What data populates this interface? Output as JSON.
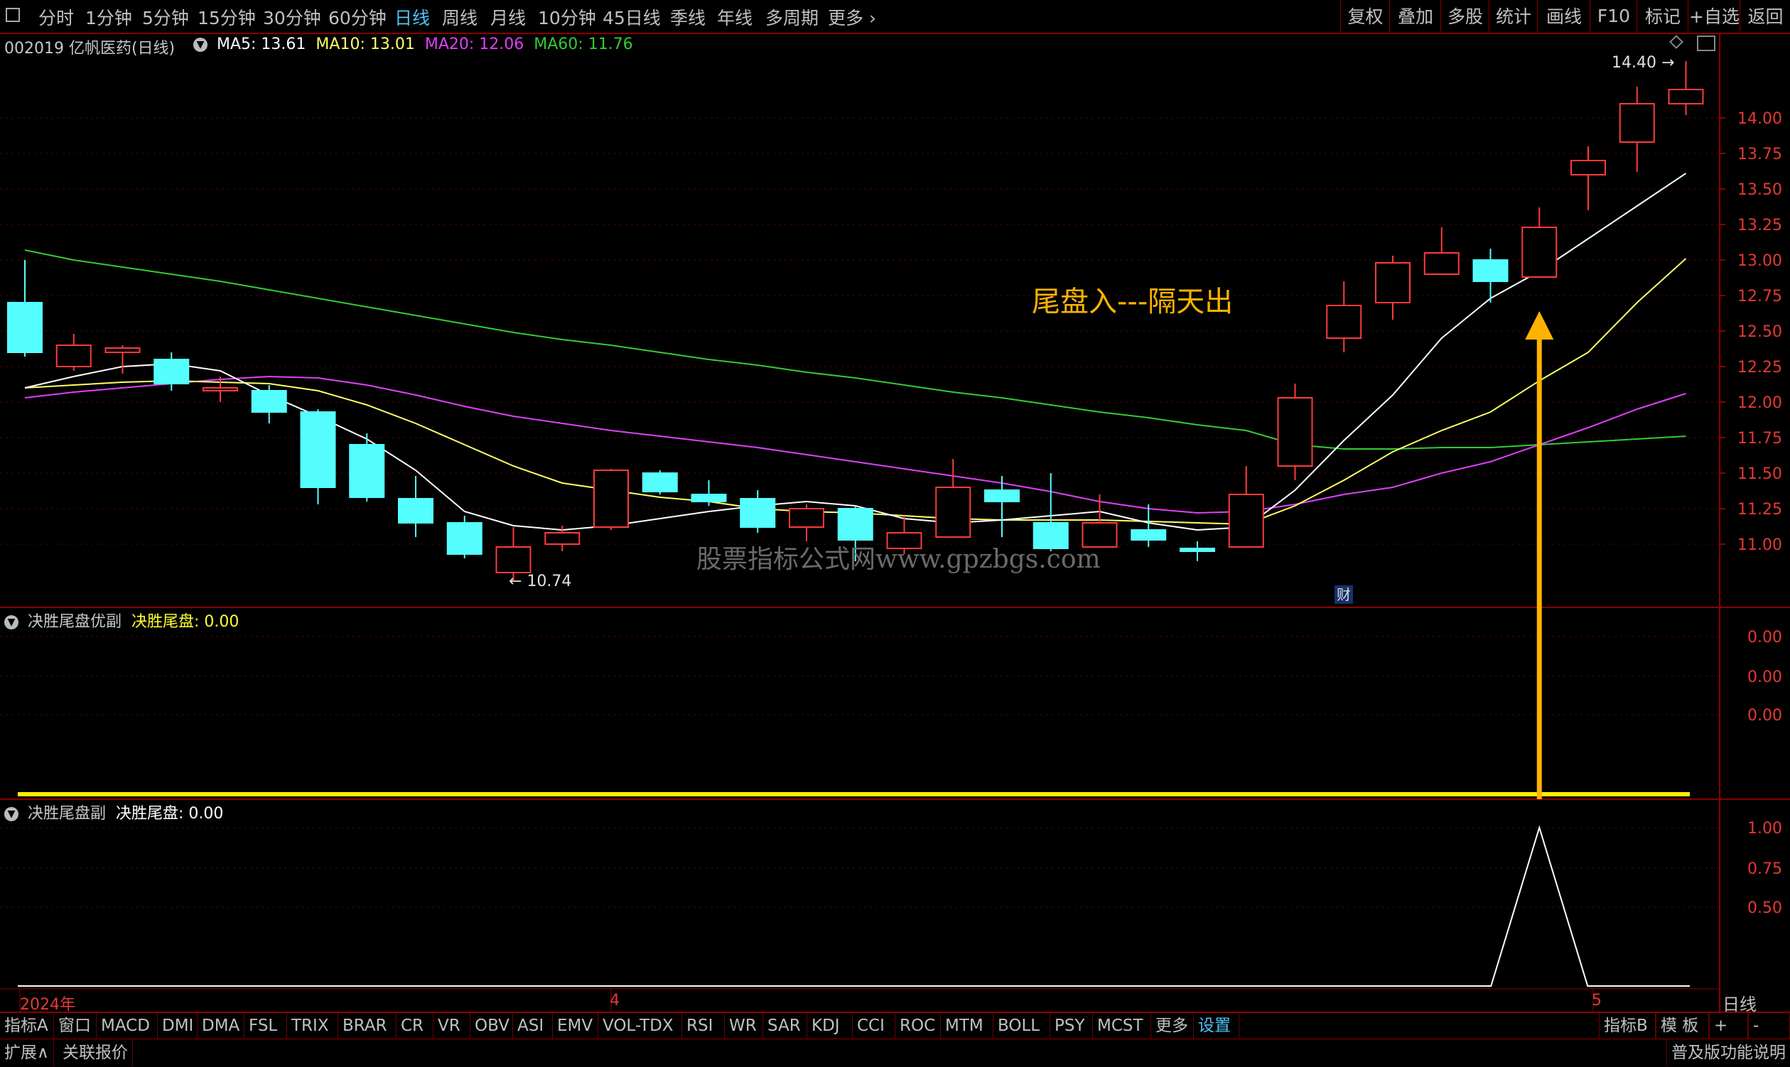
{
  "toolbar": {
    "periods": [
      "分时",
      "1分钟",
      "5分钟",
      "15分钟",
      "30分钟",
      "60分钟",
      "日线",
      "周线",
      "月线",
      "10分钟",
      "45日线",
      "季线",
      "年线",
      "多周期",
      "更多"
    ],
    "active_period": "日线",
    "right_buttons": [
      "复权",
      "叠加",
      "多股",
      "统计",
      "画线",
      "F10",
      "标记",
      "+自选",
      "返回"
    ]
  },
  "stock": {
    "title": "002019 亿帆医药(日线)",
    "ma5_label": "MA5: 13.61",
    "ma10_label": "MA10: 13.01",
    "ma20_label": "MA20: 12.06",
    "ma60_label": "MA60: 11.76",
    "colors": {
      "ma5": "#ffffff",
      "ma10": "#ffff66",
      "ma20": "#e040fb",
      "ma60": "#33cc33",
      "up": "#ff3b3b",
      "down": "#55ffff"
    }
  },
  "main_panel": {
    "y_ticks": [
      "14.00",
      "13.75",
      "13.50",
      "13.25",
      "13.00",
      "12.75",
      "12.50",
      "12.25",
      "12.00",
      "11.75",
      "11.50",
      "11.25",
      "11.00"
    ],
    "high_marker": "14.40",
    "low_marker": "10.74",
    "annotation": "尾盘入---隔天出",
    "watermark": "股票指标公式网www.gpzbgs.com",
    "fin_badge": "财"
  },
  "panel2": {
    "name": "决胜尾盘优副",
    "value_label": "决胜尾盘: 0.00",
    "y_ticks": [
      "0.00",
      "0.00",
      "0.00"
    ]
  },
  "panel3": {
    "name": "决胜尾盘副",
    "value_label": "决胜尾盘: 0.00",
    "y_ticks": [
      "1.00",
      "0.75",
      "0.50"
    ]
  },
  "x_axis": {
    "year": "2024年",
    "month4": "4",
    "month5": "5",
    "scale_button": "日线"
  },
  "tabs": [
    "指标A",
    "窗口",
    "MACD",
    "DMI",
    "DMA",
    "FSL",
    "TRIX",
    "BRAR",
    "CR",
    "VR",
    "OBV",
    "ASI",
    "EMV",
    "VOL-TDX",
    "RSI",
    "WR",
    "SAR",
    "KDJ",
    "CCI",
    "ROC",
    "MTM",
    "BOLL",
    "PSY",
    "MCST",
    "更多",
    "设置"
  ],
  "tabs_right": [
    "指标B",
    "模 板",
    "+",
    "-"
  ],
  "status": {
    "expand": "扩展∧",
    "related": "关联报价",
    "edition": "普及版功能说明"
  },
  "chart_data": {
    "type": "candlestick",
    "candles": [
      {
        "o": 12.7,
        "c": 12.35,
        "h": 13.0,
        "l": 12.32
      },
      {
        "o": 12.25,
        "c": 12.4,
        "h": 12.48,
        "l": 12.22
      },
      {
        "o": 12.35,
        "c": 12.38,
        "h": 12.4,
        "l": 12.2
      },
      {
        "o": 12.3,
        "c": 12.13,
        "h": 12.35,
        "l": 12.08
      },
      {
        "o": 12.08,
        "c": 12.1,
        "h": 12.18,
        "l": 12.0
      },
      {
        "o": 12.08,
        "c": 11.93,
        "h": 12.12,
        "l": 11.85
      },
      {
        "o": 11.93,
        "c": 11.4,
        "h": 11.95,
        "l": 11.28
      },
      {
        "o": 11.7,
        "c": 11.33,
        "h": 11.78,
        "l": 11.3
      },
      {
        "o": 11.32,
        "c": 11.15,
        "h": 11.48,
        "l": 11.05
      },
      {
        "o": 11.15,
        "c": 10.93,
        "h": 11.2,
        "l": 10.9
      },
      {
        "o": 10.8,
        "c": 10.98,
        "h": 11.12,
        "l": 10.74
      },
      {
        "o": 11.0,
        "c": 11.08,
        "h": 11.13,
        "l": 10.95
      },
      {
        "o": 11.12,
        "c": 11.52,
        "h": 11.53,
        "l": 11.1
      },
      {
        "o": 11.5,
        "c": 11.37,
        "h": 11.52,
        "l": 11.35
      },
      {
        "o": 11.35,
        "c": 11.3,
        "h": 11.45,
        "l": 11.27
      },
      {
        "o": 11.32,
        "c": 11.12,
        "h": 11.38,
        "l": 11.08
      },
      {
        "o": 11.12,
        "c": 11.25,
        "h": 11.28,
        "l": 11.02
      },
      {
        "o": 11.25,
        "c": 11.03,
        "h": 11.27,
        "l": 10.88
      },
      {
        "o": 10.97,
        "c": 11.08,
        "h": 11.2,
        "l": 10.93
      },
      {
        "o": 11.05,
        "c": 11.4,
        "h": 11.6,
        "l": 11.05
      },
      {
        "o": 11.38,
        "c": 11.3,
        "h": 11.48,
        "l": 11.05
      },
      {
        "o": 11.15,
        "c": 10.97,
        "h": 11.5,
        "l": 10.95
      },
      {
        "o": 10.98,
        "c": 11.15,
        "h": 11.35,
        "l": 10.98
      },
      {
        "o": 11.1,
        "c": 11.03,
        "h": 11.28,
        "l": 10.98
      },
      {
        "o": 10.97,
        "c": 10.95,
        "h": 11.02,
        "l": 10.88
      },
      {
        "o": 10.98,
        "c": 11.35,
        "h": 11.55,
        "l": 10.98
      },
      {
        "o": 11.55,
        "c": 12.03,
        "h": 12.13,
        "l": 11.45
      },
      {
        "o": 12.45,
        "c": 12.68,
        "h": 12.85,
        "l": 12.35
      },
      {
        "o": 12.7,
        "c": 12.98,
        "h": 13.03,
        "l": 12.58
      },
      {
        "o": 12.9,
        "c": 13.05,
        "h": 13.23,
        "l": 12.9
      },
      {
        "o": 13.0,
        "c": 12.85,
        "h": 13.08,
        "l": 12.7
      },
      {
        "o": 12.88,
        "c": 13.23,
        "h": 13.37,
        "l": 12.88
      },
      {
        "o": 13.6,
        "c": 13.7,
        "h": 13.8,
        "l": 13.35
      },
      {
        "o": 13.83,
        "c": 14.1,
        "h": 14.22,
        "l": 13.62
      },
      {
        "o": 14.1,
        "c": 14.2,
        "h": 14.4,
        "l": 14.02
      }
    ],
    "ma5": [
      12.1,
      12.18,
      12.25,
      12.27,
      12.22,
      12.05,
      11.9,
      11.74,
      11.52,
      11.23,
      11.13,
      11.1,
      11.13,
      11.18,
      11.23,
      11.27,
      11.3,
      11.27,
      11.18,
      11.15,
      11.17,
      11.2,
      11.23,
      11.15,
      11.1,
      11.12,
      11.38,
      11.73,
      12.05,
      12.45,
      12.73,
      12.92,
      13.15,
      13.38,
      13.61
    ],
    "ma10": [
      12.1,
      12.12,
      12.14,
      12.15,
      12.14,
      12.13,
      12.08,
      11.98,
      11.85,
      11.7,
      11.55,
      11.43,
      11.38,
      11.33,
      11.3,
      11.25,
      11.23,
      11.22,
      11.2,
      11.18,
      11.17,
      11.17,
      11.17,
      11.16,
      11.15,
      11.14,
      11.27,
      11.45,
      11.65,
      11.8,
      11.93,
      12.15,
      12.35,
      12.7,
      13.01
    ],
    "ma20": [
      12.03,
      12.07,
      12.1,
      12.13,
      12.16,
      12.18,
      12.17,
      12.12,
      12.05,
      11.97,
      11.9,
      11.85,
      11.8,
      11.76,
      11.72,
      11.68,
      11.63,
      11.58,
      11.53,
      11.48,
      11.43,
      11.37,
      11.3,
      11.25,
      11.22,
      11.23,
      11.28,
      11.35,
      11.4,
      11.5,
      11.58,
      11.7,
      11.82,
      11.95,
      12.06
    ],
    "ma60": [
      13.07,
      13.0,
      12.95,
      12.9,
      12.85,
      12.79,
      12.73,
      12.67,
      12.61,
      12.55,
      12.49,
      12.44,
      12.4,
      12.35,
      12.3,
      12.26,
      12.21,
      12.17,
      12.12,
      12.07,
      12.03,
      11.98,
      11.93,
      11.89,
      11.84,
      11.8,
      11.7,
      11.67,
      11.67,
      11.68,
      11.68,
      11.7,
      11.72,
      11.74,
      11.76
    ],
    "signal_index": 31,
    "panel3_values": [
      0,
      0,
      0,
      0,
      0,
      0,
      0,
      0,
      0,
      0,
      0,
      0,
      0,
      0,
      0,
      0,
      0,
      0,
      0,
      0,
      0,
      0,
      0,
      0,
      0,
      0,
      0,
      0,
      0,
      0,
      0,
      1,
      0,
      0,
      0
    ]
  }
}
